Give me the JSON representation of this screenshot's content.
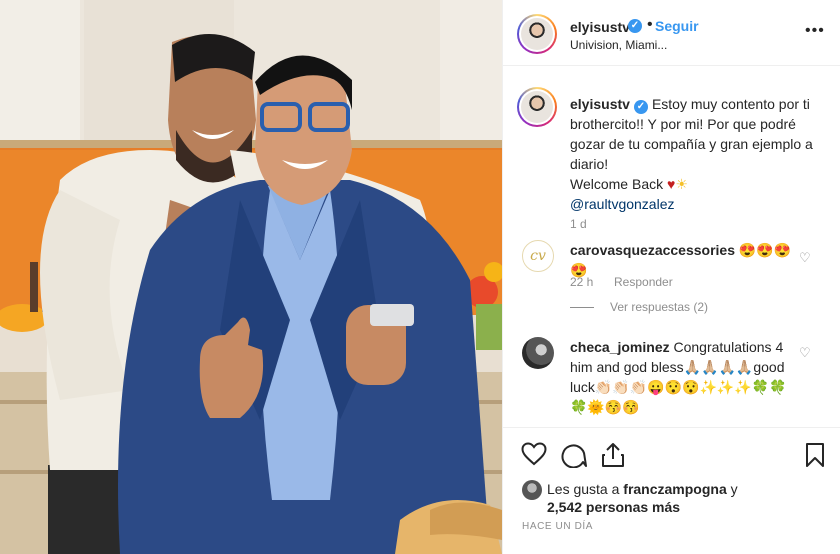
{
  "header": {
    "username": "elyisustv",
    "follow_label": "Seguir",
    "location": "Univision, Miami...",
    "separator": "•",
    "more_icon": "more-horizontal-icon"
  },
  "caption": {
    "username": "elyisustv",
    "text": "Estoy muy contento por ti brothercito!! Y por mi! Por que podré gozar de tu compañía y gran ejemplo a diario!",
    "welcome": "Welcome Back ",
    "heart_emoji": "♥",
    "sun_emoji": "☀",
    "mention": "@raultvgonzalez",
    "time": "1 d"
  },
  "comments": [
    {
      "username": "carovasquezaccessories",
      "text": "😍😍😍😍",
      "time": "22 h",
      "reply_label": "Responder",
      "view_replies": "Ver respuestas (2)",
      "avatar_text": "cv"
    },
    {
      "username": "checa_jominez",
      "text": "Congratulations 4 him and god bless🙏🏼🙏🏼🙏🏼🙏🏼good luck👏🏻👏🏻👏🏻😛😯😯✨✨✨🍀🍀🍀🌞😚😚"
    }
  ],
  "likes": {
    "prefix": "Les gusta a ",
    "user": "franczampogna",
    "suffix": " y",
    "count_text": "2,542 personas más"
  },
  "date_ago": "HACE UN DÍA",
  "colors": {
    "follow": "#3897f0",
    "mention": "#003569",
    "muted": "#8e8e8e",
    "text": "#262626"
  }
}
